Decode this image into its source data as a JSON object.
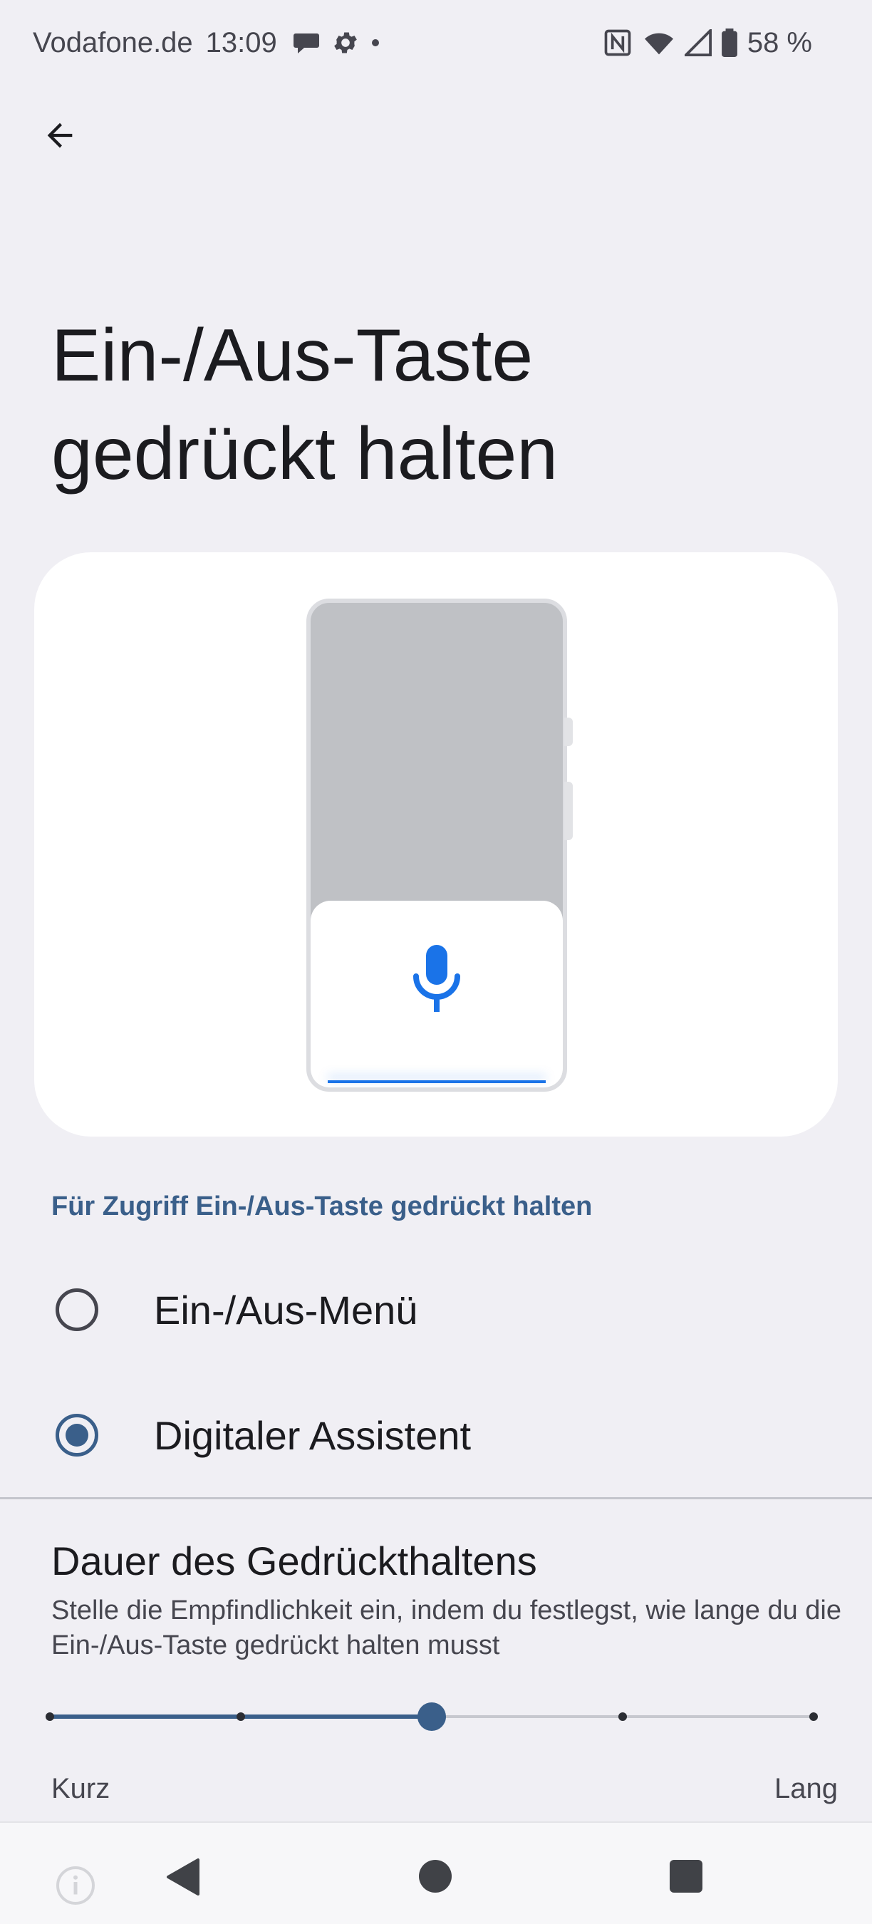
{
  "status_bar": {
    "carrier": "Vodafone.de",
    "time": "13:09",
    "battery": "58 %",
    "icons_left": [
      "chat-bubble-icon",
      "gear-icon",
      "dot-icon"
    ],
    "icons_right": [
      "nfc-icon",
      "wifi-icon",
      "signal-icon",
      "battery-icon"
    ]
  },
  "header": {
    "back_icon": "arrow-back-icon",
    "title": "Ein-/Aus-Taste gedrückt halten"
  },
  "illustration": {
    "icon": "microphone-icon",
    "accent_color": "#1a73e8"
  },
  "section": {
    "label": "Für Zugriff Ein-/Aus-Taste gedrückt halten",
    "options": [
      {
        "label": "Ein-/Aus-Menü",
        "selected": false
      },
      {
        "label": "Digitaler Assistent",
        "selected": true
      }
    ]
  },
  "duration": {
    "title": "Dauer des Gedrückthaltens",
    "description": "Stelle die Empfindlichkeit ein, indem du festlegst, wie lange du die Ein-/Aus-Taste gedrückt halten musst",
    "steps": 5,
    "selected_step": 3,
    "min_label": "Kurz",
    "max_label": "Lang"
  },
  "nav_bar": {
    "icons": [
      "info-icon",
      "back-triangle-icon",
      "home-circle-icon",
      "recents-square-icon"
    ]
  },
  "colors": {
    "background": "#f0eff4",
    "accent": "#3a5f8a",
    "card": "#ffffff"
  }
}
